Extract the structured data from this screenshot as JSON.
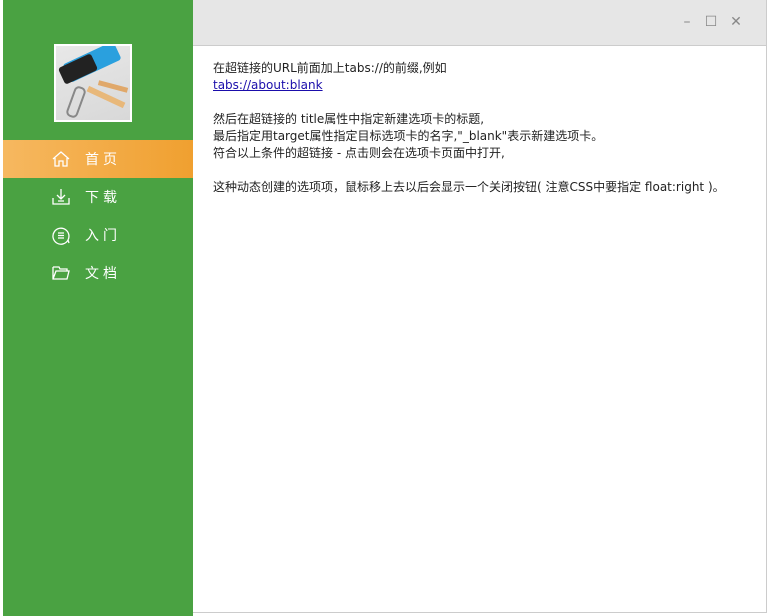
{
  "sidebar": {
    "items": [
      {
        "label": "首页",
        "icon": "home-icon",
        "active": true
      },
      {
        "label": "下载",
        "icon": "download-icon"
      },
      {
        "label": "入门",
        "icon": "chat-icon"
      },
      {
        "label": "文档",
        "icon": "folder-icon"
      }
    ],
    "active_color": "#f0a030",
    "bg_color": "#4aa242"
  },
  "window": {
    "minimize": "–",
    "maximize": "☐",
    "close": "✕"
  },
  "content": {
    "line1": "在超链接的URL前面加上tabs://的前缀,例如",
    "link": "tabs://about:blank",
    "line2": "然后在超链接的 title属性中指定新建选项卡的标题,",
    "line3": "最后指定用target属性指定目标选项卡的名字,\"_blank\"表示新建选项卡。",
    "line4": "符合以上条件的超链接 - 点击则会在选项卡页面中打开,",
    "line5": "这种动态创建的选项项，鼠标移上去以后会显示一个关闭按钮( 注意CSS中要指定 float:right )。"
  }
}
